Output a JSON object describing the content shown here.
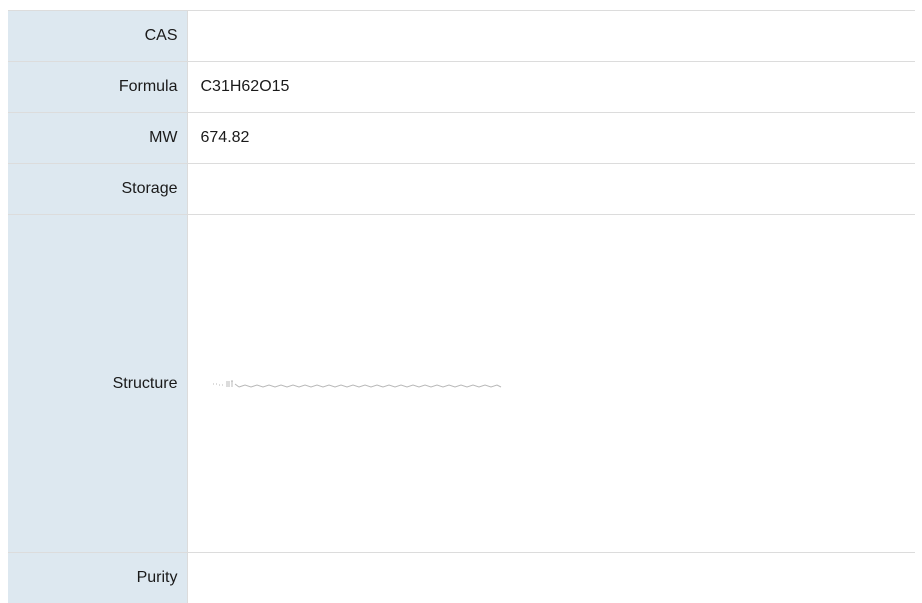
{
  "rows": [
    {
      "label": "CAS",
      "value": ""
    },
    {
      "label": "Formula",
      "value": "C31H62O15"
    },
    {
      "label": "MW",
      "value": "674.82"
    },
    {
      "label": "Storage",
      "value": ""
    },
    {
      "label": "Structure",
      "value": ""
    },
    {
      "label": "Purity",
      "value": ""
    }
  ],
  "colors": {
    "label_background": "#dde8f0",
    "border": "#dcdcdc",
    "text": "#1a1a1a"
  },
  "icons": {
    "structure": "chemical-structure-image"
  }
}
